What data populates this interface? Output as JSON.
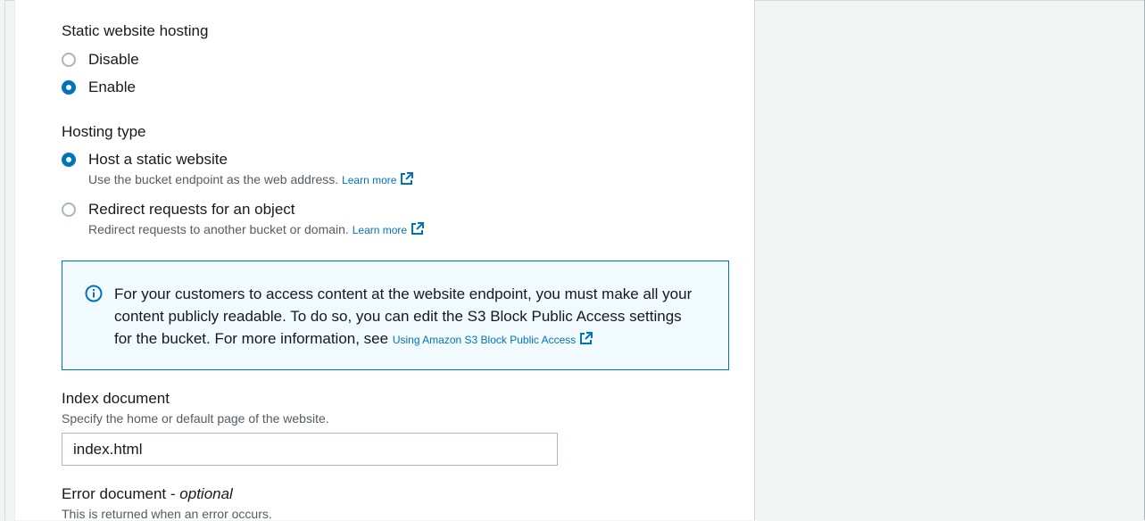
{
  "static_hosting": {
    "label": "Static website hosting",
    "options": [
      {
        "label": "Disable",
        "selected": false
      },
      {
        "label": "Enable",
        "selected": true
      }
    ]
  },
  "hosting_type": {
    "label": "Hosting type",
    "options": [
      {
        "label": "Host a static website",
        "description": "Use the bucket endpoint as the web address.",
        "link": "Learn more",
        "selected": true
      },
      {
        "label": "Redirect requests for an object",
        "description": "Redirect requests to another bucket or domain.",
        "link": "Learn more",
        "selected": false
      }
    ]
  },
  "info": {
    "text": "For your customers to access content at the website endpoint, you must make all your content publicly readable. To do so, you can edit the S3 Block Public Access settings for the bucket. For more information, see",
    "link": "Using Amazon S3 Block Public Access"
  },
  "index_document": {
    "label": "Index document",
    "description": "Specify the home or default page of the website.",
    "value": "index.html"
  },
  "error_document": {
    "label": "Error document",
    "optional_sep": " - ",
    "optional": "optional",
    "description": "This is returned when an error occurs."
  },
  "colors": {
    "accent": "#0073bb",
    "info_bg": "#f1faff",
    "text": "#16191f",
    "secondary_text": "#545b64"
  }
}
